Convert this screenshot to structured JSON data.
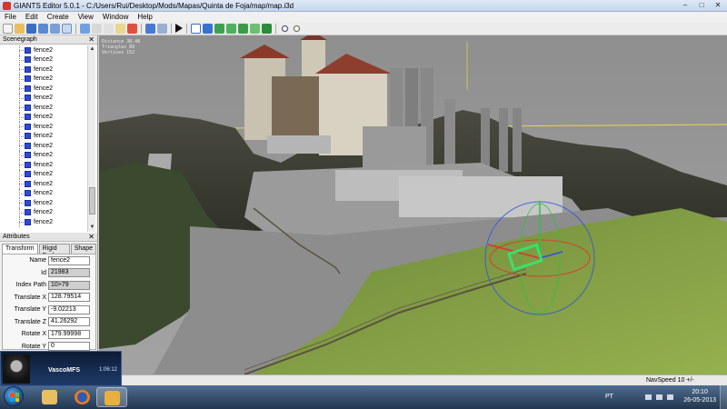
{
  "window": {
    "title": "GIANTS Editor 5.0.1 - C:/Users/Rui/Desktop/Mods/Mapas/Quinta de Foja/map/map.i3d",
    "minimize": "–",
    "maximize": "□",
    "close": "✕"
  },
  "menu": [
    {
      "label": "File"
    },
    {
      "label": "Edit"
    },
    {
      "label": "Create"
    },
    {
      "label": "View"
    },
    {
      "label": "Window"
    },
    {
      "label": "Help"
    }
  ],
  "scenegraph": {
    "title": "Scenegraph",
    "close": "✕",
    "items": [
      {
        "label": "fence2"
      },
      {
        "label": "fence2"
      },
      {
        "label": "fence2"
      },
      {
        "label": "fence2"
      },
      {
        "label": "fence2"
      },
      {
        "label": "fence2"
      },
      {
        "label": "fence2"
      },
      {
        "label": "fence2"
      },
      {
        "label": "fence2"
      },
      {
        "label": "fence2"
      },
      {
        "label": "fence2"
      },
      {
        "label": "fence2"
      },
      {
        "label": "fence2"
      },
      {
        "label": "fence2"
      },
      {
        "label": "fence2"
      },
      {
        "label": "fence2"
      },
      {
        "label": "fence2"
      },
      {
        "label": "fence2"
      },
      {
        "label": "fence2"
      }
    ]
  },
  "attributes": {
    "title": "Attributes",
    "close": "✕",
    "tabs": [
      {
        "label": "Transform"
      },
      {
        "label": "Rigid Body"
      },
      {
        "label": "Shape"
      }
    ],
    "fields": [
      {
        "key": "Name",
        "value": "fence2"
      },
      {
        "key": "Id",
        "value": "21983"
      },
      {
        "key": "Index Path",
        "value": "10>79"
      },
      {
        "key": "Translate X",
        "value": "128.79514"
      },
      {
        "key": "Translate Y",
        "value": "-9.02213"
      },
      {
        "key": "Translate Z",
        "value": "41.26292"
      },
      {
        "key": "Rotate X",
        "value": "179.99998"
      },
      {
        "key": "Rotate Y",
        "value": "0"
      }
    ]
  },
  "viewport": {
    "stats": [
      "Distance 38.48",
      "Triangles 89",
      "Vertices 152"
    ]
  },
  "status": {
    "navspeed": "NavSpeed 10 +/-"
  },
  "overlay": {
    "name": "VascoMFS",
    "clock": "1:06:12"
  },
  "taskbar": {
    "lang": "PT",
    "time": "20:10",
    "date": "26-05-2013"
  },
  "colors": {
    "selection": "#39e06b",
    "gizmo_x": "#e03030",
    "gizmo_y": "#30c040",
    "gizmo_z": "#3050e0"
  }
}
